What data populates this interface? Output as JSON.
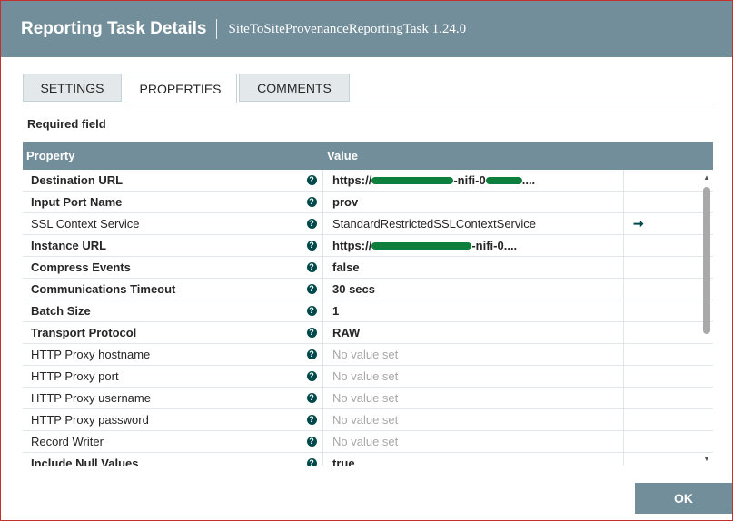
{
  "dialog": {
    "title": "Reporting Task Details",
    "subtitle": "SiteToSiteProvenanceReportingTask 1.24.0"
  },
  "tabs": [
    {
      "label": "SETTINGS",
      "active": false
    },
    {
      "label": "PROPERTIES",
      "active": true
    },
    {
      "label": "COMMENTS",
      "active": false
    }
  ],
  "required_label": "Required field",
  "table": {
    "columns": {
      "property": "Property",
      "value": "Value"
    },
    "rows": [
      {
        "name": "Destination URL",
        "value_parts": [
          "https://",
          "-nifi-0",
          "...."
        ],
        "required": true,
        "empty": false
      },
      {
        "name": "Input Port Name",
        "value": "prov",
        "required": true,
        "empty": false
      },
      {
        "name": "SSL Context Service",
        "value": "StandardRestrictedSSLContextService",
        "required": false,
        "empty": false,
        "goto": true
      },
      {
        "name": "Instance URL",
        "value_parts": [
          "https://",
          "-nifi-0.",
          "..."
        ],
        "required": true,
        "empty": false
      },
      {
        "name": "Compress Events",
        "value": "false",
        "required": true,
        "empty": false
      },
      {
        "name": "Communications Timeout",
        "value": "30 secs",
        "required": true,
        "empty": false
      },
      {
        "name": "Batch Size",
        "value": "1",
        "required": true,
        "empty": false
      },
      {
        "name": "Transport Protocol",
        "value": "RAW",
        "required": true,
        "empty": false
      },
      {
        "name": "HTTP Proxy hostname",
        "value": "No value set",
        "required": false,
        "empty": true
      },
      {
        "name": "HTTP Proxy port",
        "value": "No value set",
        "required": false,
        "empty": true
      },
      {
        "name": "HTTP Proxy username",
        "value": "No value set",
        "required": false,
        "empty": true
      },
      {
        "name": "HTTP Proxy password",
        "value": "No value set",
        "required": false,
        "empty": true
      },
      {
        "name": "Record Writer",
        "value": "No value set",
        "required": false,
        "empty": true
      },
      {
        "name": "Include Null Values",
        "value": "true",
        "required": true,
        "empty": false
      }
    ]
  },
  "icons": {
    "help": "question-circle-icon",
    "goto": "arrow-right-icon"
  },
  "help_glyph": "?",
  "goto_glyph": "➞",
  "ok_label": "OK",
  "colors": {
    "header": "#728e9b",
    "accent": "#004849",
    "redaction": "#0e7e3d"
  }
}
